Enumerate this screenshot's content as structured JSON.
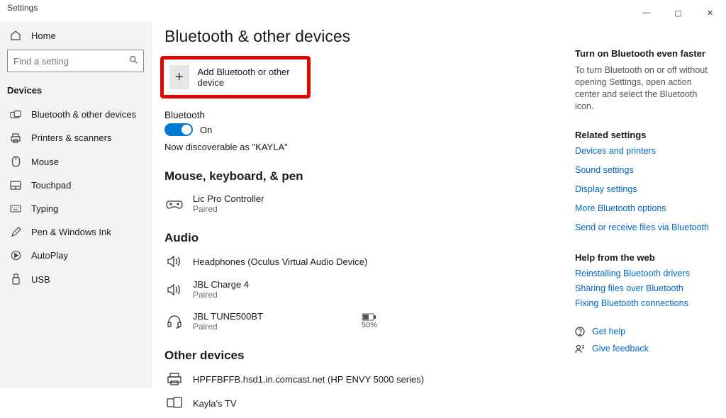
{
  "window": {
    "title": "Settings",
    "controls": {
      "min": "—",
      "max": "▢",
      "close": "✕"
    }
  },
  "sidebar": {
    "home": "Home",
    "search_placeholder": "Find a setting",
    "group": "Devices",
    "items": [
      {
        "label": "Bluetooth & other devices"
      },
      {
        "label": "Printers & scanners"
      },
      {
        "label": "Mouse"
      },
      {
        "label": "Touchpad"
      },
      {
        "label": "Typing"
      },
      {
        "label": "Pen & Windows Ink"
      },
      {
        "label": "AutoPlay"
      },
      {
        "label": "USB"
      }
    ]
  },
  "page": {
    "title": "Bluetooth & other devices",
    "add_label": "Add Bluetooth or other device",
    "bluetooth_label": "Bluetooth",
    "toggle_state": "On",
    "discoverable": "Now discoverable as \"KAYLA\"",
    "sections": {
      "mouse": {
        "heading": "Mouse, keyboard, & pen",
        "devices": [
          {
            "name": "Lic Pro Controller",
            "status": "Paired"
          }
        ]
      },
      "audio": {
        "heading": "Audio",
        "devices": [
          {
            "name": "Headphones (Oculus Virtual Audio Device)",
            "status": ""
          },
          {
            "name": "JBL Charge 4",
            "status": "Paired"
          },
          {
            "name": "JBL TUNE500BT",
            "status": "Paired",
            "battery": "50%"
          }
        ]
      },
      "other": {
        "heading": "Other devices",
        "devices": [
          {
            "name": "HPFFBFFB.hsd1.in.comcast.net (HP ENVY 5000 series)",
            "status": ""
          },
          {
            "name": "Kayla's TV",
            "status": ""
          }
        ]
      }
    }
  },
  "aside": {
    "tip_heading": "Turn on Bluetooth even faster",
    "tip_body": "To turn Bluetooth on or off without opening Settings, open action center and select the Bluetooth icon.",
    "related_heading": "Related settings",
    "related": [
      "Devices and printers",
      "Sound settings",
      "Display settings",
      "More Bluetooth options",
      "Send or receive files via Bluetooth"
    ],
    "help_heading": "Help from the web",
    "help": [
      "Reinstalling Bluetooth drivers",
      "Sharing files over Bluetooth",
      "Fixing Bluetooth connections"
    ],
    "get_help": "Get help",
    "feedback": "Give feedback"
  }
}
